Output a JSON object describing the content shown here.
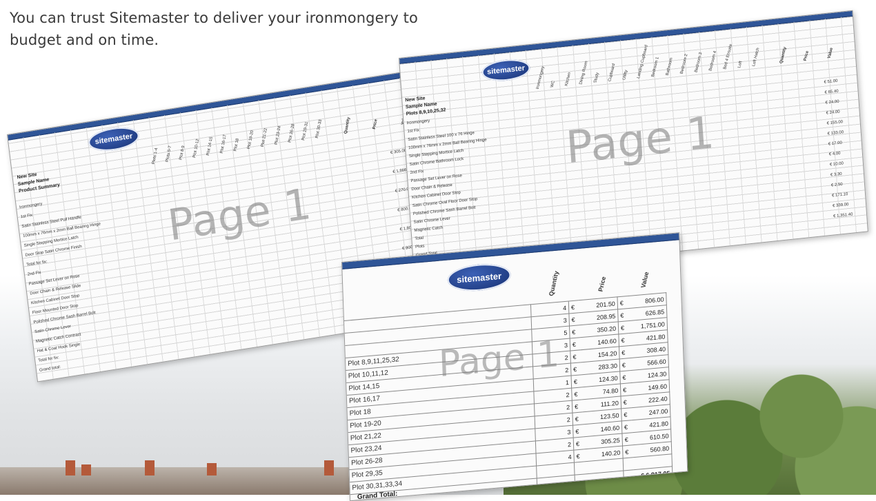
{
  "intro": {
    "line1": "You can trust Sitemaster to deliver your ironmongery to",
    "line2": "budget and on time."
  },
  "colors": {
    "titlebar": "#2f5597",
    "logo": "#223f86",
    "text": "#3a3a3a"
  },
  "watermark": "Page 1",
  "logo_text": "sitemaster",
  "left_sheet": {
    "header_lines": [
      "New Site",
      "Sample Name",
      "Product Summary"
    ],
    "column_heads": [
      "Plots 1-4",
      "Plots 5-7",
      "Plot 8-9",
      "Plot 10-12",
      "Plot 14-15",
      "Plot 16-17",
      "Plot 18",
      "Plot 19-20",
      "Plot 21-22",
      "Plot 23-24",
      "Plot 26-28",
      "Plot 29-31",
      "Plot 30-33"
    ],
    "right_heads": [
      "Quantity",
      "Price",
      "Value"
    ],
    "row_labels": [
      "Ironmongery",
      "1st Fix",
      "Satin Stainless Steel Pull Handle",
      "100mm x 76mm x 2mm Ball Bearing Hinge",
      "Single Stepping Mortice Latch",
      "Door Stop Satin Chrome Finish",
      "Total for fix:",
      "2nd Fix",
      "Passage Set Lever on Rose",
      "Door Chain & Release Slide",
      "Kitchen Cabinet Door Stop",
      "Floor Mounted Door Stop",
      "Polished Chrome Sash Barrel Bolt",
      "Satin Chrome Lever",
      "Magnetic Catch Contract",
      "Hat & Coat Hook Single",
      "Total for fix:",
      "Grand total:"
    ],
    "values": [
      "€ 305.00",
      "€ 1,866.00",
      "€ 270.00",
      "€ 800.00",
      "€ 1,800.00",
      "€ 900.00",
      "€ 1,586.77",
      "€ 6,817.05"
    ]
  },
  "right_sheet": {
    "header_lines": [
      "New Site",
      "Sample Name",
      "Plots 8,9,10,25,32"
    ],
    "column_heads": [
      "Ironmongery",
      "WC",
      "Kitchen",
      "Dining Room",
      "Study",
      "Cupboard",
      "Utility",
      "Landing Cupboard",
      "Bedroom 1",
      "Bathroom",
      "Bedroom 2",
      "Bedroom 3",
      "Bedroom 4",
      "Bed 4 Ensuite",
      "Loft",
      "Loft Hatch"
    ],
    "right_heads": [
      "Quantity",
      "Price",
      "Value"
    ],
    "row_labels": [
      "Ironmongery",
      "1st Fix",
      "Satin Stainless Steel 100 x 76 Hinge",
      "100mm x 76mm x 2mm Ball Bearing Hinge",
      "Single Stepping Mortice Latch",
      "Satin Chrome Bathroom Lock",
      "2nd Fix",
      "Passage Set Lever on Rose",
      "Door Chain & Release",
      "Kitchen Cabinet Door Stop",
      "Satin Chrome Oval Floor Door Stop",
      "Polished Chrome Sash Barrel Bolt",
      "Satin Chrome Lever",
      "Magnetic Catch",
      "Total",
      "Plots",
      "Grand Total"
    ],
    "values": [
      "€ 51.00",
      "€ 65.40",
      "€ 24.00",
      "€ 24.00",
      "€ 155.00",
      "€ 133.00",
      "€ 17.00",
      "€ 4.00",
      "€ 10.00",
      "€ 3.30",
      "€ 2.50",
      "€ 171.10",
      "€ 339.00",
      "€ 1,351.40"
    ]
  },
  "front_sheet": {
    "headers": {
      "quantity": "Quantity",
      "price": "Price",
      "value": "Value"
    },
    "rows": [
      {
        "plot": "",
        "qty": "4",
        "price": "201.50",
        "value": "806.00"
      },
      {
        "plot": "",
        "qty": "3",
        "price": "208.95",
        "value": "626.85"
      },
      {
        "plot": "",
        "qty": "5",
        "price": "350.20",
        "value": "1,751.00"
      },
      {
        "plot": "Plot 8,9,11,25,32",
        "qty": "3",
        "price": "140.60",
        "value": "421.80"
      },
      {
        "plot": "Plot 10,11,12",
        "qty": "2",
        "price": "154.20",
        "value": "308.40"
      },
      {
        "plot": "Plot 14,15",
        "qty": "2",
        "price": "283.30",
        "value": "566.60"
      },
      {
        "plot": "Plot 16,17",
        "qty": "1",
        "price": "124.30",
        "value": "124.30"
      },
      {
        "plot": "Plot 18",
        "qty": "2",
        "price": "74.80",
        "value": "149.60"
      },
      {
        "plot": "Plot 19-20",
        "qty": "2",
        "price": "111.20",
        "value": "222.40"
      },
      {
        "plot": "Plot 21,22",
        "qty": "2",
        "price": "123.50",
        "value": "247.00"
      },
      {
        "plot": "Plot 23,24",
        "qty": "3",
        "price": "140.60",
        "value": "421.80"
      },
      {
        "plot": "Plot 26-28",
        "qty": "2",
        "price": "305.25",
        "value": "610.50"
      },
      {
        "plot": "Plot 29,35",
        "qty": "4",
        "price": "140.20",
        "value": "560.80"
      },
      {
        "plot": "Plot 30,31,33,34",
        "qty": "",
        "price": "",
        "value": ""
      }
    ],
    "total_value": "€ 6,817.05",
    "grand_total_label": "Grand Total:",
    "currency": "€"
  }
}
